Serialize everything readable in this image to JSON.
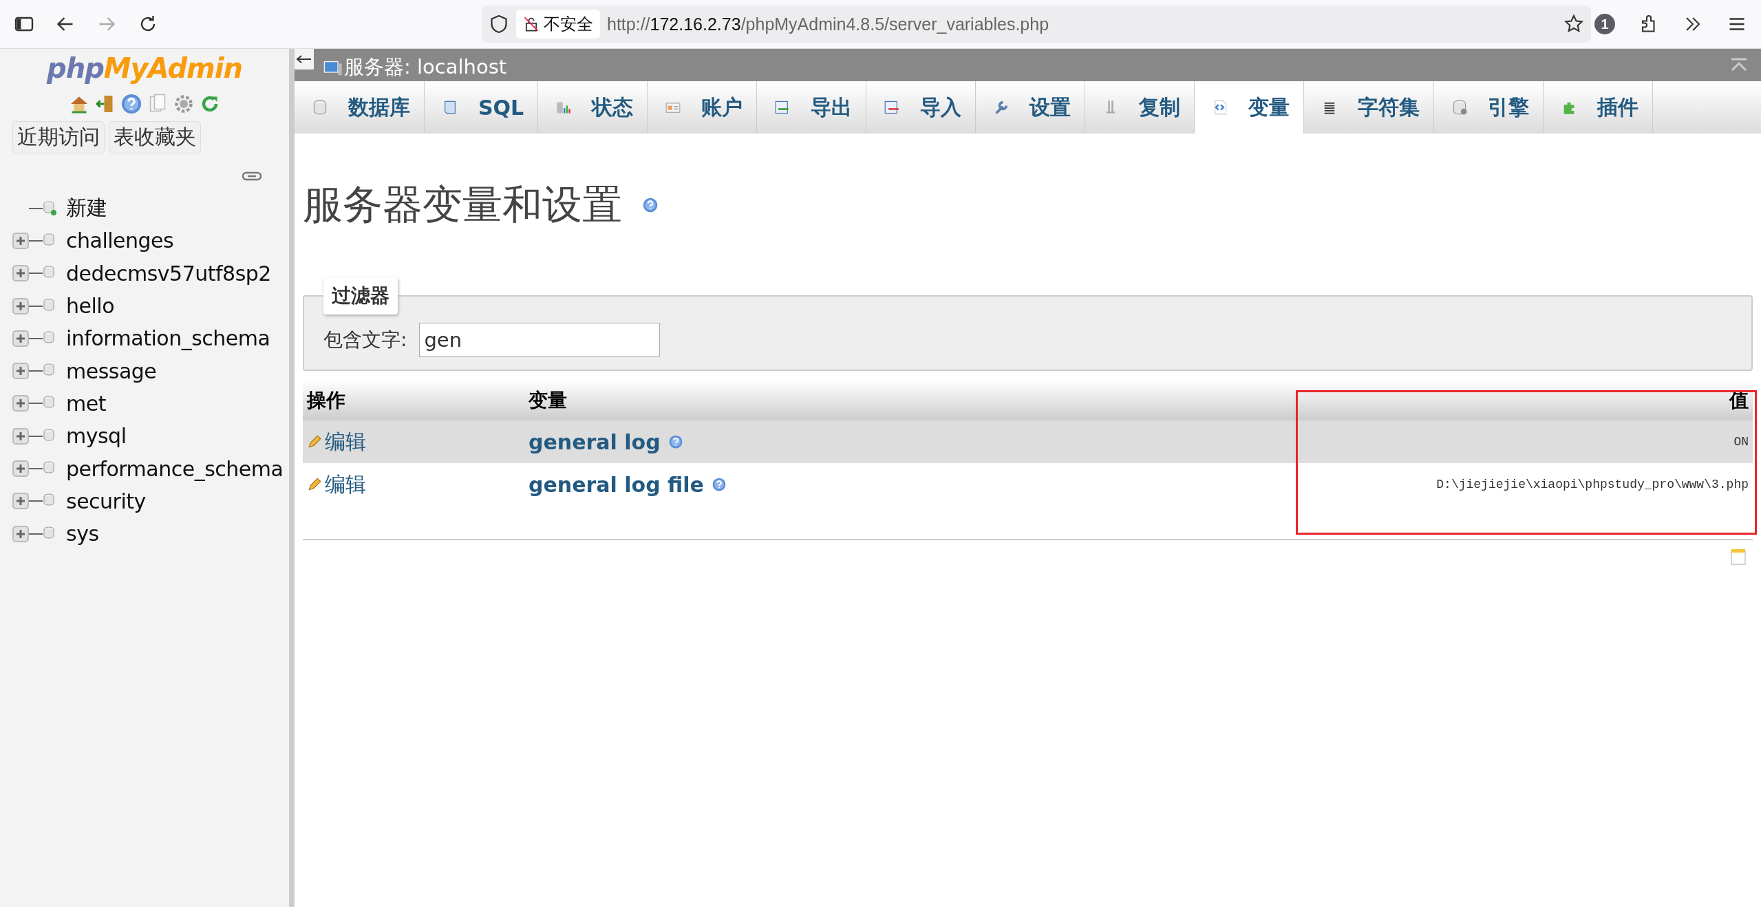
{
  "browser": {
    "security_label": "不安全",
    "url_scheme": "http://",
    "url_host": "172.16.2.73",
    "url_path": "/phpMyAdmin4.8.5/server_variables.php",
    "notification_count": "1"
  },
  "sidebar": {
    "logo_left": "php",
    "logo_right": "MyAdmin",
    "buttons": [
      "近期访问",
      "表收藏夹"
    ],
    "tree": [
      {
        "label": "新建",
        "kind": "new"
      },
      {
        "label": "challenges",
        "kind": "db",
        "expanded": false
      },
      {
        "label": "dedecmsv57utf8sp2",
        "kind": "db",
        "expanded": false
      },
      {
        "label": "hello",
        "kind": "db",
        "expanded": false
      },
      {
        "label": "information_schema",
        "kind": "db",
        "expanded": false
      },
      {
        "label": "message",
        "kind": "db",
        "expanded": false
      },
      {
        "label": "met",
        "kind": "db",
        "expanded": false
      },
      {
        "label": "mysql",
        "kind": "db",
        "expanded": false
      },
      {
        "label": "performance_schema",
        "kind": "db",
        "expanded": false
      },
      {
        "label": "security",
        "kind": "db",
        "expanded": false
      },
      {
        "label": "sys",
        "kind": "db",
        "expanded": false
      }
    ]
  },
  "server_bar": {
    "label": "服务器: localhost"
  },
  "tabs": [
    {
      "label": "数据库",
      "selected": false
    },
    {
      "label": "SQL",
      "selected": false
    },
    {
      "label": "状态",
      "selected": false
    },
    {
      "label": "账户",
      "selected": false
    },
    {
      "label": "导出",
      "selected": false
    },
    {
      "label": "导入",
      "selected": false
    },
    {
      "label": "设置",
      "selected": false
    },
    {
      "label": "复制",
      "selected": false
    },
    {
      "label": "变量",
      "selected": true
    },
    {
      "label": "字符集",
      "selected": false
    },
    {
      "label": "引擎",
      "selected": false
    },
    {
      "label": "插件",
      "selected": false
    }
  ],
  "page": {
    "heading": "服务器变量和设置"
  },
  "filter": {
    "legend": "过滤器",
    "label": "包含文字:",
    "value": "gen"
  },
  "table": {
    "columns": [
      "操作",
      "变量",
      "值"
    ],
    "rows": [
      {
        "action": "编辑",
        "name": "general log",
        "value": "ON",
        "highlighted": true
      },
      {
        "action": "编辑",
        "name": "general log file",
        "value": "D:\\jiejiejie\\xiaopi\\phpstudy_pro\\www\\3.php",
        "highlighted": false
      }
    ]
  }
}
